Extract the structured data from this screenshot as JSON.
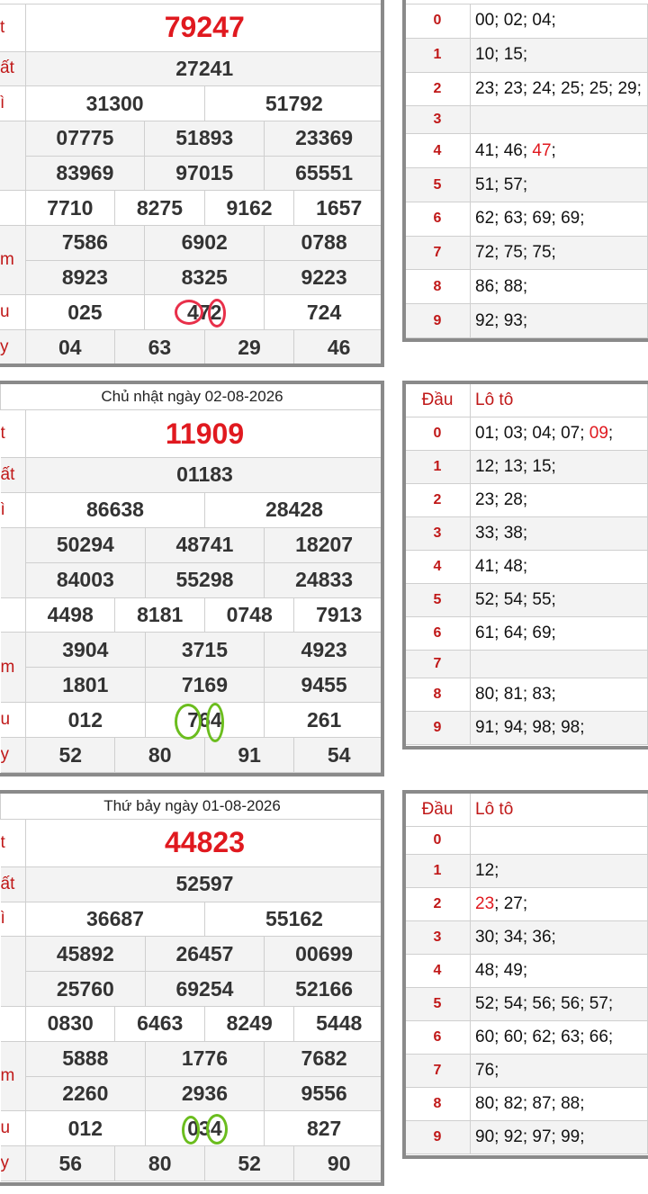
{
  "blocks": [
    {
      "date": "",
      "labels": [
        "t",
        "ất",
        "ì",
        "",
        "",
        "",
        "m",
        "",
        "u",
        "y"
      ],
      "special": "79247",
      "first": "27241",
      "second": [
        "31300",
        "51792"
      ],
      "third_a": [
        "07775",
        "51893",
        "23369"
      ],
      "third_b": [
        "83969",
        "97015",
        "65551"
      ],
      "fourth": [
        "7710",
        "8275",
        "9162",
        "1657"
      ],
      "fifth_a": [
        "7586",
        "6902",
        "0788"
      ],
      "fifth_b": [
        "8923",
        "8325",
        "9223"
      ],
      "sixth": [
        "025",
        "472",
        "724"
      ],
      "seventh": [
        "04",
        "63",
        "29",
        "46"
      ]
    },
    {
      "date": "Chủ nhật ngày 02-08-2026",
      "labels": [
        "t",
        "ất",
        "ì",
        "",
        "",
        "",
        "m",
        "",
        "u",
        "y"
      ],
      "special": "11909",
      "first": "01183",
      "second": [
        "86638",
        "28428"
      ],
      "third_a": [
        "50294",
        "48741",
        "18207"
      ],
      "third_b": [
        "84003",
        "55298",
        "24833"
      ],
      "fourth": [
        "4498",
        "8181",
        "0748",
        "7913"
      ],
      "fifth_a": [
        "3904",
        "3715",
        "4923"
      ],
      "fifth_b": [
        "1801",
        "7169",
        "9455"
      ],
      "sixth": [
        "012",
        "764",
        "261"
      ],
      "seventh": [
        "52",
        "80",
        "91",
        "54"
      ]
    },
    {
      "date": "Thứ bảy ngày 01-08-2026",
      "labels": [
        "t",
        "ất",
        "ì",
        "",
        "",
        "",
        "m",
        "",
        "u",
        "y"
      ],
      "special": "44823",
      "first": "52597",
      "second": [
        "36687",
        "55162"
      ],
      "third_a": [
        "45892",
        "26457",
        "00699"
      ],
      "third_b": [
        "25760",
        "69254",
        "52166"
      ],
      "fourth": [
        "0830",
        "6463",
        "8249",
        "5448"
      ],
      "fifth_a": [
        "5888",
        "1776",
        "7682"
      ],
      "fifth_b": [
        "2260",
        "2936",
        "9556"
      ],
      "sixth": [
        "012",
        "034",
        "827"
      ],
      "seventh": [
        "56",
        "80",
        "52",
        "90"
      ]
    }
  ],
  "loto": [
    {
      "header": null,
      "rows": [
        {
          "dau": "0",
          "pre": "00; 02; 04;",
          "hl": "",
          "post": ""
        },
        {
          "dau": "1",
          "pre": "10; 15;",
          "hl": "",
          "post": ""
        },
        {
          "dau": "2",
          "pre": "23; 23; 24; 25; 25; 29;",
          "hl": "",
          "post": ""
        },
        {
          "dau": "3",
          "pre": "",
          "hl": "",
          "post": ""
        },
        {
          "dau": "4",
          "pre": "41; 46; ",
          "hl": "47",
          "post": ";"
        },
        {
          "dau": "5",
          "pre": "51; 57;",
          "hl": "",
          "post": ""
        },
        {
          "dau": "6",
          "pre": "62; 63; 69; 69;",
          "hl": "",
          "post": ""
        },
        {
          "dau": "7",
          "pre": "72; 75; 75;",
          "hl": "",
          "post": ""
        },
        {
          "dau": "8",
          "pre": "86; 88;",
          "hl": "",
          "post": ""
        },
        {
          "dau": "9",
          "pre": "92; 93;",
          "hl": "",
          "post": ""
        }
      ]
    },
    {
      "header": {
        "dau": "Đầu",
        "loto": "Lô tô"
      },
      "rows": [
        {
          "dau": "0",
          "pre": "01; 03; 04; 07; ",
          "hl": "09",
          "post": ";"
        },
        {
          "dau": "1",
          "pre": "12; 13; 15;",
          "hl": "",
          "post": ""
        },
        {
          "dau": "2",
          "pre": "23; 28;",
          "hl": "",
          "post": ""
        },
        {
          "dau": "3",
          "pre": "33; 38;",
          "hl": "",
          "post": ""
        },
        {
          "dau": "4",
          "pre": "41; 48;",
          "hl": "",
          "post": ""
        },
        {
          "dau": "5",
          "pre": "52; 54; 55;",
          "hl": "",
          "post": ""
        },
        {
          "dau": "6",
          "pre": "61; 64; 69;",
          "hl": "",
          "post": ""
        },
        {
          "dau": "7",
          "pre": "",
          "hl": "",
          "post": ""
        },
        {
          "dau": "8",
          "pre": "80; 81; 83;",
          "hl": "",
          "post": ""
        },
        {
          "dau": "9",
          "pre": "91; 94; 98; 98;",
          "hl": "",
          "post": ""
        }
      ]
    },
    {
      "header": {
        "dau": "Đầu",
        "loto": "Lô tô"
      },
      "rows": [
        {
          "dau": "0",
          "pre": "",
          "hl": "",
          "post": ""
        },
        {
          "dau": "1",
          "pre": "12;",
          "hl": "",
          "post": ""
        },
        {
          "dau": "2",
          "pre": "",
          "hl": "23",
          "post": "; 27;"
        },
        {
          "dau": "3",
          "pre": "30; 34; 36;",
          "hl": "",
          "post": ""
        },
        {
          "dau": "4",
          "pre": "48; 49;",
          "hl": "",
          "post": ""
        },
        {
          "dau": "5",
          "pre": "52; 54; 56; 56; 57;",
          "hl": "",
          "post": ""
        },
        {
          "dau": "6",
          "pre": "60; 60; 62; 63; 66;",
          "hl": "",
          "post": ""
        },
        {
          "dau": "7",
          "pre": "76;",
          "hl": "",
          "post": ""
        },
        {
          "dau": "8",
          "pre": "80; 82; 87; 88;",
          "hl": "",
          "post": ""
        },
        {
          "dau": "9",
          "pre": "90; 92; 97; 99;",
          "hl": "",
          "post": ""
        }
      ]
    }
  ],
  "colors": {
    "prize_red": "#e0191f",
    "label_red": "#c01818",
    "mark_red": "#e8304a",
    "mark_green": "#6bbd1e"
  }
}
